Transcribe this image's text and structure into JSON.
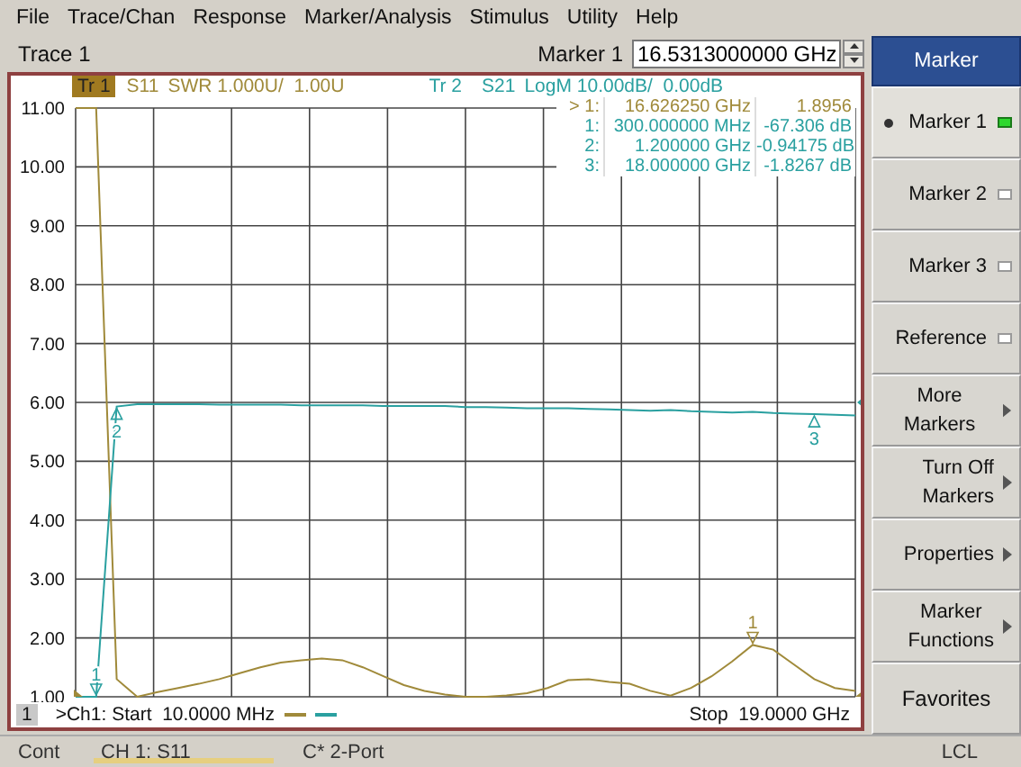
{
  "menu": [
    "File",
    "Trace/Chan",
    "Response",
    "Marker/Analysis",
    "Stimulus",
    "Utility",
    "Help"
  ],
  "toolbar": {
    "trace": "Trace 1",
    "marker_label": "Marker 1",
    "marker_value": "16.5313000000 GHz"
  },
  "traces": [
    {
      "label": "Tr 1",
      "selected": true,
      "format": "SWR 1.000U/  1.00U",
      "color": "#a08a3a"
    },
    {
      "label": "Tr 2",
      "selected": false,
      "format": "LogM 10.00dB/  0.00dB",
      "color": "#2aa0a0"
    }
  ],
  "marker_table": [
    {
      "label": "> 1:",
      "stimulus": "16.626250 GHz",
      "response": "1.8956",
      "color": "#a08a3a"
    },
    {
      "label": "1:",
      "stimulus": "300.000000 MHz",
      "response": "-67.306 dB",
      "color": "#2aa0a0"
    },
    {
      "label": "2:",
      "stimulus": "1.200000 GHz",
      "response": "-0.94175 dB",
      "color": "#2aa0a0"
    },
    {
      "label": "3:",
      "stimulus": "18.000000 GHz",
      "response": "-1.8267 dB",
      "color": "#2aa0a0"
    }
  ],
  "chart_data": {
    "type": "line",
    "categories": [
      null,
      null,
      null,
      null,
      null,
      null,
      null,
      null,
      null,
      null,
      null,
      null,
      null,
      null,
      null,
      null,
      null,
      null,
      null,
      null,
      null,
      null,
      null,
      null,
      null,
      null,
      null,
      null,
      null,
      null,
      null,
      null,
      null,
      null,
      null,
      null,
      null,
      null,
      null
    ],
    "ylim": [
      1,
      11
    ],
    "yticks": [
      {
        "value": 1,
        "label": "1.00"
      },
      {
        "value": 2,
        "label": "2.00"
      },
      {
        "value": 3,
        "label": "3.00"
      },
      {
        "value": 4,
        "label": "4.00"
      },
      {
        "value": 5,
        "label": "5.00"
      },
      {
        "value": 6,
        "label": "6.00"
      },
      {
        "value": 7,
        "label": "7.00"
      },
      {
        "value": 8,
        "label": "8.00"
      },
      {
        "value": 9,
        "label": "9.00"
      },
      {
        "value": 10,
        "label": "10.00"
      },
      {
        "value": 11,
        "label": "11.00"
      }
    ],
    "series": [
      {
        "name": "S11",
        "color": "#a08a3a",
        "values": [
          11,
          11,
          1.3,
          1.0,
          1.08,
          1.15,
          1.22,
          1.3,
          1.4,
          1.5,
          1.58,
          1.62,
          1.65,
          1.62,
          1.5,
          1.35,
          1.2,
          1.1,
          1.04,
          1.0,
          1.0,
          1.02,
          1.06,
          1.15,
          1.28,
          1.3,
          1.25,
          1.22,
          1.1,
          1.02,
          1.15,
          1.35,
          1.6,
          1.88,
          1.8,
          1.55,
          1.3,
          1.15,
          1.1
        ]
      },
      {
        "name": "S21",
        "color": "#2aa0a0",
        "values": [
          1.0,
          1.0,
          5.93,
          5.97,
          5.97,
          5.97,
          5.97,
          5.96,
          5.96,
          5.96,
          5.96,
          5.95,
          5.95,
          5.95,
          5.95,
          5.94,
          5.94,
          5.94,
          5.94,
          5.92,
          5.92,
          5.91,
          5.9,
          5.9,
          5.9,
          5.89,
          5.88,
          5.87,
          5.86,
          5.87,
          5.85,
          5.84,
          5.83,
          5.84,
          5.82,
          5.81,
          5.8,
          5.79,
          5.78
        ]
      }
    ],
    "annotations": [
      {
        "y": 1.88,
        "text": "1"
      },
      {
        "y": 1.0,
        "text": "1"
      },
      {
        "y": 5.93,
        "text": "2"
      },
      {
        "y": 5.8,
        "text": "3"
      }
    ],
    "grid": true
  },
  "legend": {
    "channel": "1",
    "start": ">Ch1: Start  10.0000 MHz",
    "stop": "Stop  19.0000 GHz"
  },
  "softkeys": [
    {
      "kind": "header",
      "label": "Marker",
      "selected": false
    },
    {
      "kind": "toggle",
      "label": "Marker 1",
      "on": true,
      "selected": true
    },
    {
      "kind": "toggle",
      "label": "Marker 2",
      "on": false,
      "selected": false
    },
    {
      "kind": "toggle",
      "label": "Marker 3",
      "on": false,
      "selected": false
    },
    {
      "kind": "toggle",
      "label": "Reference",
      "on": false,
      "selected": false
    },
    {
      "kind": "submenu",
      "label": "More Markers",
      "selected": false
    },
    {
      "kind": "submenu",
      "label": "Turn Off\nMarkers",
      "selected": false
    },
    {
      "kind": "submenu",
      "label": "Properties",
      "selected": false
    },
    {
      "kind": "submenu",
      "label": "Marker\nFunctions",
      "selected": false
    },
    {
      "kind": "plain",
      "label": "Favorites",
      "selected": false
    }
  ],
  "status_bar": {
    "mode": "Cont",
    "channel": "CH 1: S11",
    "calibration": "C* 2-Port",
    "remote": "LCL"
  }
}
